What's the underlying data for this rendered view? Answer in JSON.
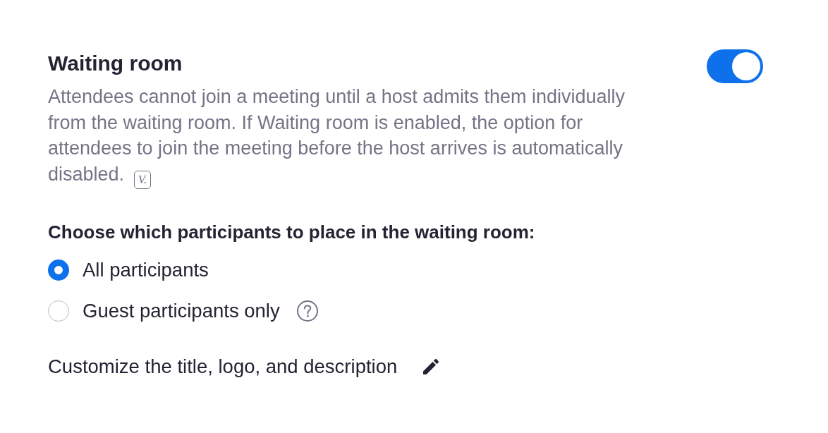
{
  "setting": {
    "title": "Waiting room",
    "enabled": true,
    "description": "Attendees cannot join a meeting until a host admits them individually from the waiting room. If Waiting room is enabled, the option for attendees to join the meeting before the host arrives is automatically disabled.",
    "version_badge": "V."
  },
  "participants": {
    "heading": "Choose which participants to place in the waiting room:",
    "options": [
      {
        "label": "All participants",
        "selected": true,
        "help": false
      },
      {
        "label": "Guest participants only",
        "selected": false,
        "help": true
      }
    ]
  },
  "customize": {
    "label": "Customize the title, logo, and description"
  }
}
